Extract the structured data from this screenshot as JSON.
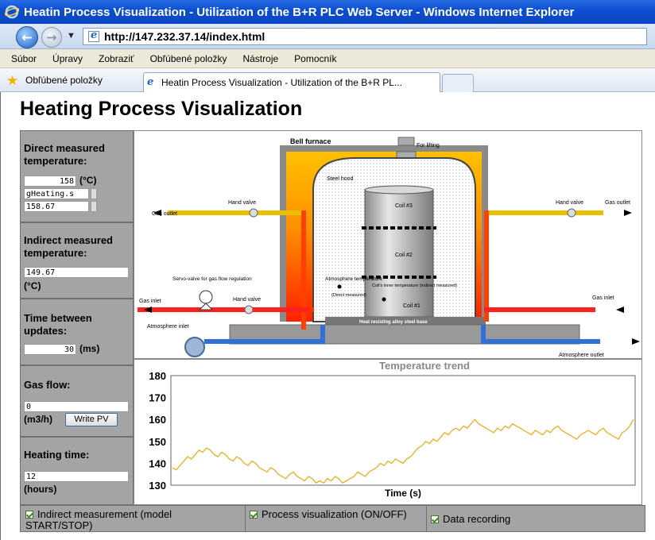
{
  "window": {
    "title": "Heatin Process Visualization - Utilization of the B+R PLC Web Server - Windows Internet Explorer"
  },
  "address": {
    "url": "http://147.232.37.14/index.html"
  },
  "menu": {
    "items": [
      "Súbor",
      "Úpravy",
      "Zobraziť",
      "Obľúbené položky",
      "Nástroje",
      "Pomocník"
    ]
  },
  "favorites": {
    "label": "Obľúbené položky",
    "tab_title": "Heatin Process Visualization - Utilization of the B+R PL..."
  },
  "page": {
    "title": "Heating Process Visualization"
  },
  "panel": {
    "direct": {
      "label": "Direct measured temperature:",
      "value": "158",
      "unit": "(°C)",
      "var_name": "gHeating.s",
      "precise": "158.67"
    },
    "indirect": {
      "label": "Indirect measured temperature:",
      "value": "149.67",
      "unit": "(°C)"
    },
    "update": {
      "label": "Time between updates:",
      "value": "30",
      "unit": "(ms)"
    },
    "gas": {
      "label": "Gas flow:",
      "value": "0",
      "unit": "(m3/h)",
      "button": "Write PV"
    },
    "heating": {
      "label": "Heating time:",
      "value": "12",
      "unit": "(hours)"
    }
  },
  "diagram": {
    "labels": {
      "bell_furnace": "Bell furnace",
      "for_lifting": "For lifting",
      "steel_hood": "Steel hood",
      "coil3": "Coil #3",
      "coil2": "Coil #2",
      "coil1": "Coil #1",
      "coil_inner": "Coil's inner temperature (indirect measured)",
      "atm_temp": "Atmosphere temperature",
      "direct_measured": "(Direct measured)",
      "base": "Heat resisting alloy steel base",
      "hand_valve_l": "Hand valve",
      "hand_valve_r": "Hand valve",
      "hand_valve_in": "Hand valve",
      "gas_outlet_l": "Gas outlet",
      "gas_outlet_r": "Gas outlet",
      "gas_inlet_l": "Gas inlet",
      "gas_inlet_r": "Gas inlet",
      "servo": "Servo-valve for gas flow regulation",
      "atm_inlet": "Atmosphere inlet",
      "atm_outlet": "Atmosphere outlet"
    },
    "colors": {
      "hot": "#ff2a00",
      "warm": "#ffc400",
      "cold": "#2f6fd6",
      "wall": "#8a8a8a"
    }
  },
  "chart_data": {
    "type": "line",
    "title": "Temperature trend",
    "xlabel": "Time (s)",
    "ylabel": "",
    "ylim": [
      130,
      180
    ],
    "yticks": [
      130,
      140,
      150,
      160,
      170,
      180
    ],
    "grid": false,
    "series": [
      {
        "color": "#e8b020",
        "values": [
          138,
          137,
          139,
          141,
          143,
          142,
          144,
          146,
          145,
          147,
          146,
          144,
          143,
          145,
          144,
          142,
          141,
          143,
          142,
          140,
          139,
          141,
          140,
          138,
          137,
          136,
          138,
          137,
          135,
          134,
          133,
          135,
          136,
          134,
          133,
          132,
          134,
          133,
          131,
          132,
          131,
          133,
          132,
          134,
          133,
          131,
          132,
          133,
          134,
          136,
          135,
          134,
          136,
          137,
          138,
          140,
          139,
          141,
          140,
          142,
          141,
          140,
          142,
          143,
          145,
          147,
          148,
          150,
          149,
          151,
          150,
          152,
          154,
          153,
          155,
          156,
          155,
          157,
          156,
          158,
          160,
          158,
          157,
          156,
          155,
          154,
          156,
          155,
          157,
          156,
          158,
          157,
          156,
          155,
          154,
          153,
          155,
          154,
          153,
          155,
          154,
          156,
          157,
          155,
          154,
          153,
          152,
          151,
          153,
          154,
          155,
          154,
          153,
          155,
          156,
          154,
          153,
          152,
          151,
          154,
          155,
          157,
          160
        ]
      }
    ]
  },
  "options": {
    "indirect": {
      "label": "Indirect measurement (model START/STOP)",
      "checked": true
    },
    "visual": {
      "label": "Process visualization (ON/OFF)",
      "checked": true
    },
    "record": {
      "label": "Data recording",
      "checked": true
    }
  }
}
